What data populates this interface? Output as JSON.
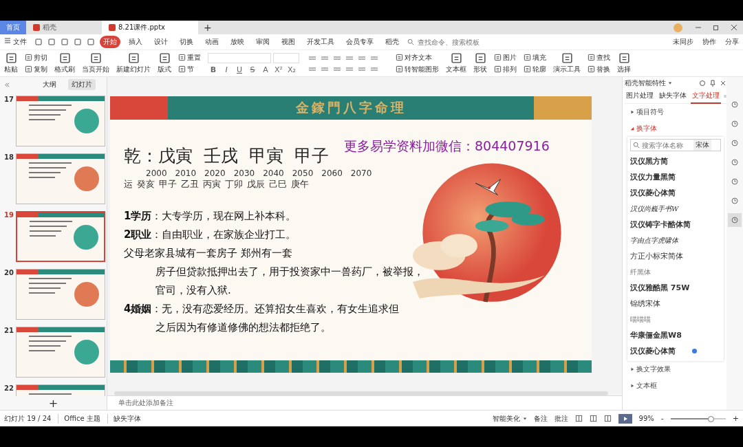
{
  "tab_bar": {
    "tabs": [
      {
        "label": "首页",
        "kind": "home",
        "selected": false
      },
      {
        "label": "稻壳",
        "kind": "app",
        "selected": false
      },
      {
        "label": "8.21课件.pptx",
        "kind": "file",
        "selected": true
      }
    ],
    "new_tab": "+"
  },
  "menu_bar": {
    "file": "文件",
    "tabs": [
      {
        "label": "开始",
        "selected": true
      },
      {
        "label": "插入",
        "selected": false
      },
      {
        "label": "设计",
        "selected": false
      },
      {
        "label": "切换",
        "selected": false
      },
      {
        "label": "动画",
        "selected": false
      },
      {
        "label": "放映",
        "selected": false
      },
      {
        "label": "审阅",
        "selected": false
      },
      {
        "label": "视图",
        "selected": false
      },
      {
        "label": "开发工具",
        "selected": false
      },
      {
        "label": "会员专享",
        "selected": false
      },
      {
        "label": "稻壳",
        "selected": false
      }
    ],
    "search": {
      "placeholder": "查找命令、搜索模板"
    },
    "actions": [
      "未同步",
      "协作",
      "分享"
    ]
  },
  "ribbon": {
    "columns": [
      [
        {
          "label": "粘贴",
          "kind": "large"
        }
      ],
      [
        {
          "label": "剪切",
          "kind": "small"
        },
        {
          "label": "复制",
          "kind": "small"
        }
      ],
      [
        {
          "label": "格式刷",
          "kind": "large"
        }
      ],
      [
        {
          "label": "当页开始",
          "kind": "large"
        }
      ],
      [
        {
          "label": "新建幻灯片",
          "kind": "large"
        }
      ],
      [
        {
          "label": "版式",
          "kind": "large"
        }
      ],
      [
        {
          "label": "重置",
          "kind": "small"
        },
        {
          "label": "节",
          "kind": "small"
        }
      ]
    ],
    "format_buttons": [
      "B",
      "I",
      "U",
      "S",
      "A",
      "X²",
      "X₂"
    ],
    "columns_after": [
      [
        {
          "label": "对齐文本",
          "kind": "small"
        },
        {
          "label": "转智能图形",
          "kind": "small"
        }
      ],
      [
        {
          "label": "文本框",
          "kind": "large"
        }
      ],
      [
        {
          "label": "形状",
          "kind": "large"
        }
      ],
      [
        {
          "label": "图片",
          "kind": "small"
        },
        {
          "label": "排列",
          "kind": "small"
        }
      ],
      [
        {
          "label": "填充",
          "kind": "small"
        },
        {
          "label": "轮廓",
          "kind": "small"
        }
      ],
      [
        {
          "label": "演示工具",
          "kind": "large"
        }
      ],
      [
        {
          "label": "查找",
          "kind": "small"
        },
        {
          "label": "替换",
          "kind": "small"
        }
      ],
      [
        {
          "label": "选择",
          "kind": "large"
        }
      ]
    ]
  },
  "left_panel": {
    "tabs": [
      {
        "label": "大纲",
        "selected": false
      },
      {
        "label": "幻灯片",
        "selected": true
      }
    ],
    "thumbnails": [
      {
        "number": "17",
        "selected": false
      },
      {
        "number": "18",
        "selected": false
      },
      {
        "number": "19",
        "selected": true
      },
      {
        "number": "20",
        "selected": false
      },
      {
        "number": "21",
        "selected": false
      },
      {
        "number": "22",
        "selected": false
      }
    ],
    "add": "+"
  },
  "slide": {
    "title": "金鎵門八字命理",
    "promo": "更多易学资料加微信：804407916",
    "heading": "乾：戊寅  壬戌  甲寅  甲子",
    "years": [
      "2000",
      "2010",
      "2020",
      "2030",
      "2040",
      "2050",
      "2060",
      "2070"
    ],
    "luck_label": "运",
    "luck": [
      "癸亥",
      "甲子",
      "乙丑",
      "丙寅",
      "丁卯",
      "戊辰",
      "己巳",
      "庚午"
    ],
    "lines": [
      {
        "text": "**1学历**：大专学历，现在网上补本科。",
        "indent": false
      },
      {
        "text": "**2职业**：自由职业，在家族企业打工。",
        "indent": false
      },
      {
        "text": "父母老家县城有一套房子 郑州有一套",
        "indent": false
      },
      {
        "text": "房子但贷款抵押出去了，用于投资家中一兽药厂，被举报，",
        "indent": true
      },
      {
        "text": "官司，没有入狱.",
        "indent": true
      },
      {
        "text": "**4婚姻**：无，没有恋爱经历。还算招女生喜欢，有女生追求但",
        "indent": false
      },
      {
        "text": "之后因为有修道修佛的想法都拒绝了。",
        "indent": true
      }
    ]
  },
  "notes": {
    "placeholder": "单击此处添加备注"
  },
  "right_panel": {
    "title": "稻壳智能特性",
    "tabs": [
      {
        "label": "图片处理",
        "selected": false
      },
      {
        "label": "缺失字体",
        "selected": false
      },
      {
        "label": "文字处理",
        "selected": true
      }
    ],
    "sections_top": [
      {
        "label": "项目符号",
        "expanded": false
      },
      {
        "label": "换字体",
        "expanded": true
      }
    ],
    "font_search": {
      "placeholder": "搜索字体名称",
      "button": "宋体"
    },
    "fonts": [
      {
        "name": "汉仪黑方简",
        "kind": "bold",
        "badge": false
      },
      {
        "name": "汉仪力量黑简",
        "kind": "bold",
        "badge": false
      },
      {
        "name": "汉仪菱心体简",
        "kind": "bold",
        "badge": false
      },
      {
        "name": "汉仪尚巍手书W",
        "kind": "script",
        "badge": false
      },
      {
        "name": "汉仪铸字卡酷体简",
        "kind": "bold",
        "badge": false
      },
      {
        "name": "字由点字虎啸体",
        "kind": "script",
        "badge": false
      },
      {
        "name": "方正小标宋简体",
        "kind": "regular",
        "badge": false
      },
      {
        "name": "纤黑体",
        "kind": "light",
        "badge": false
      },
      {
        "name": "汉仪雅酷黑 75W",
        "kind": "bold",
        "badge": false
      },
      {
        "name": "锦绣宋体",
        "kind": "regular",
        "badge": false
      },
      {
        "name": "喵喵喵",
        "kind": "light",
        "badge": false
      },
      {
        "name": "华康俪金黑W8",
        "kind": "bold",
        "badge": false
      },
      {
        "name": "汉仪菱心体简",
        "kind": "bold",
        "badge": true
      }
    ],
    "sections_bottom": [
      {
        "label": "换文字效果",
        "expanded": false
      },
      {
        "label": "文本框",
        "expanded": false
      }
    ]
  },
  "side_tools": [
    {
      "selected": false
    },
    {
      "selected": false
    },
    {
      "selected": false
    },
    {
      "selected": false
    },
    {
      "selected": false
    },
    {
      "selected": false
    },
    {
      "selected": true
    }
  ],
  "status_bar": {
    "slide": "幻灯片 19 / 24",
    "theme": "Office 主题",
    "missing_font": "缺失字体",
    "beautify": "智能美化",
    "notes": "备注",
    "comments": "批注",
    "zoom": "99%",
    "zoom_out": "-",
    "zoom_in": "+",
    "zoom_slider": {
      "level": 0.74
    }
  }
}
